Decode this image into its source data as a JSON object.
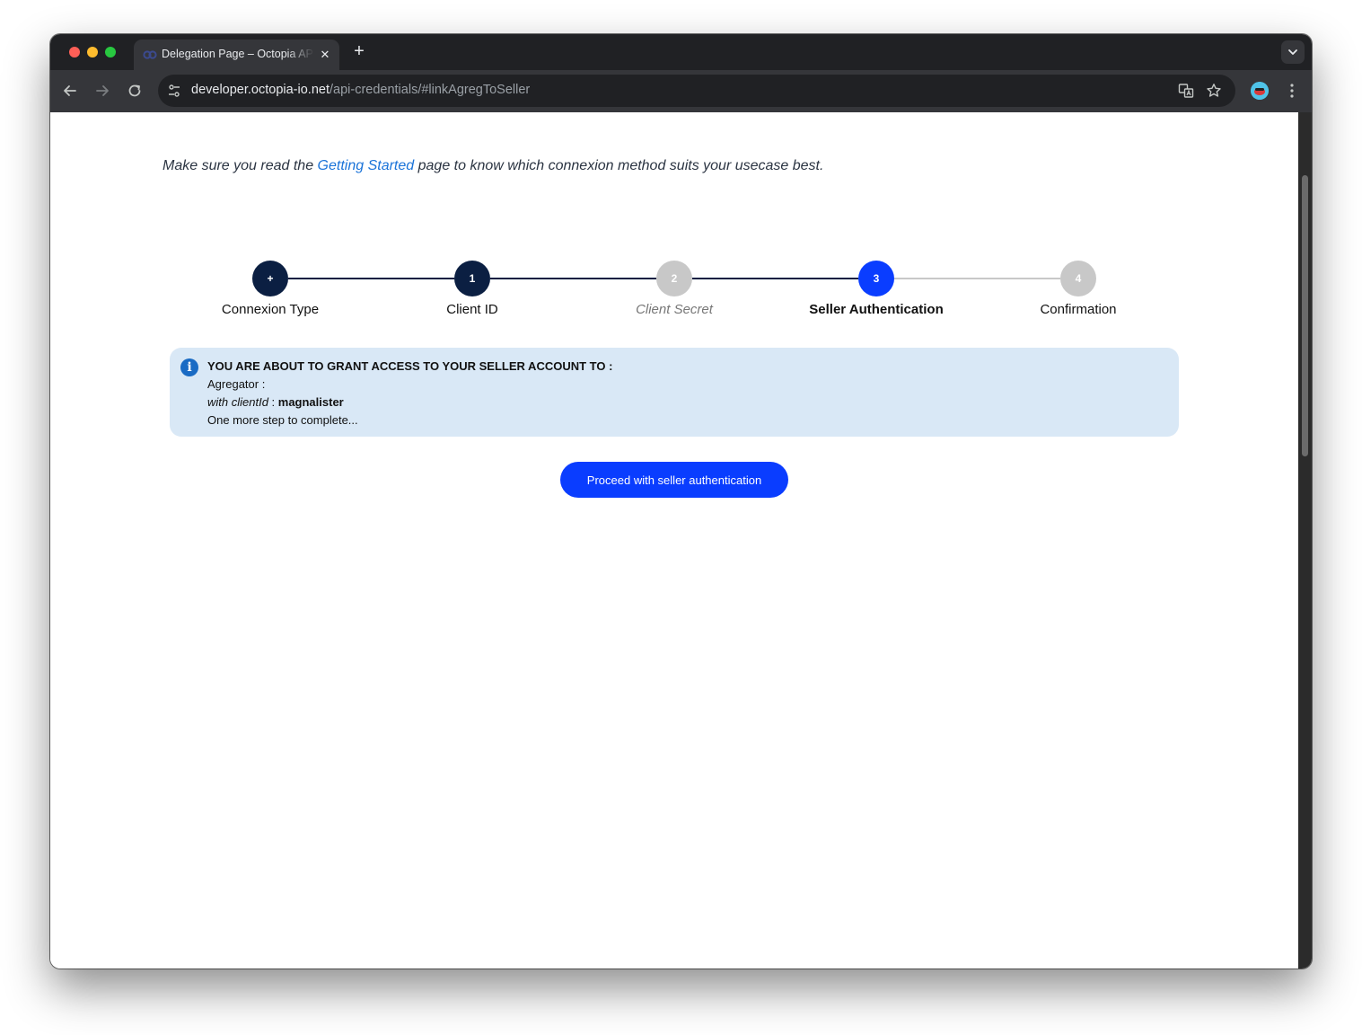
{
  "browser": {
    "tab_title": "Delegation Page – Octopia API",
    "tab_close": "✕",
    "new_tab": "+",
    "url_host": "developer.octopia-io.net",
    "url_path": "/api-credentials/#linkAgregToSeller"
  },
  "page": {
    "intro_before": "Make sure you read the ",
    "intro_link": "Getting Started",
    "intro_after": " page to know which connexion method suits your usecase best."
  },
  "stepper": {
    "steps": [
      {
        "symbol": "+",
        "label": "Connexion Type",
        "state": "done",
        "color": "#0b1f42"
      },
      {
        "symbol": "1",
        "label": "Client ID",
        "state": "done",
        "color": "#0b1f42"
      },
      {
        "symbol": "2",
        "label": "Client Secret",
        "state": "skipped",
        "color": "#c8c8c8"
      },
      {
        "symbol": "3",
        "label": "Seller Authentication",
        "state": "active",
        "color": "#0a3dff"
      },
      {
        "symbol": "4",
        "label": "Confirmation",
        "state": "pending",
        "color": "#c8c8c8"
      }
    ]
  },
  "info": {
    "title": "YOU ARE ABOUT TO GRANT ACCESS TO YOUR SELLER ACCOUNT TO :",
    "agregator_label": "Agregator :",
    "clientid_label": "with clientId",
    "clientid_sep": " : ",
    "clientid_value": "magnalister",
    "footer": "One more step to complete..."
  },
  "actions": {
    "proceed_label": "Proceed with seller authentication"
  }
}
